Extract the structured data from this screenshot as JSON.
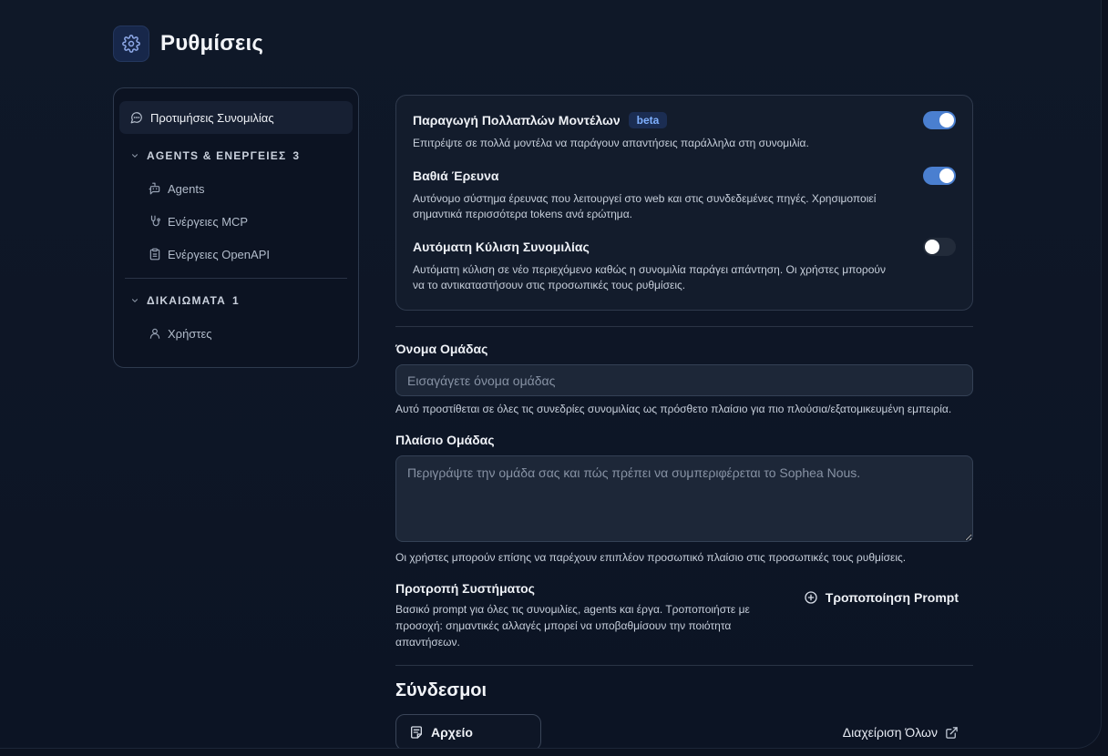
{
  "header": {
    "title": "Ρυθμίσεις",
    "icon": "gear-icon"
  },
  "sidebar": {
    "top_item": {
      "label": "Προτιμήσεις Συνομιλίας",
      "icon": "chat-bubble-icon"
    },
    "groups": [
      {
        "label": "AGENTS & ΕΝΕΡΓΕΙΕΣ",
        "count": "3",
        "items": [
          {
            "label": "Agents",
            "icon": "bot-message-icon"
          },
          {
            "label": "Ενέργειες MCP",
            "icon": "plug-route-icon"
          },
          {
            "label": "Ενέργειες OpenAPI",
            "icon": "clipboard-icon"
          }
        ]
      },
      {
        "label": "ΔΙΚΑΙΩΜΑΤΑ",
        "count": "1",
        "items": [
          {
            "label": "Χρήστες",
            "icon": "user-icon"
          }
        ]
      }
    ]
  },
  "options": [
    {
      "title": "Παραγωγή Πολλαπλών Μοντέλων",
      "badge": "beta",
      "description": "Επιτρέψτε σε πολλά μοντέλα να παράγουν απαντήσεις παράλληλα στη συνομιλία.",
      "enabled": true
    },
    {
      "title": "Βαθιά Έρευνα",
      "description": "Αυτόνομο σύστημα έρευνας που λειτουργεί στο web και στις συνδεδεμένες πηγές. Χρησιμοποιεί σημαντικά περισσότερα tokens ανά ερώτημα.",
      "enabled": true
    },
    {
      "title": "Αυτόματη Κύλιση Συνομιλίας",
      "description": "Αυτόματη κύλιση σε νέο περιεχόμενο καθώς η συνομιλία παράγει απάντηση. Οι χρήστες μπορούν να το αντικαταστήσουν στις προσωπικές τους ρυθμίσεις.",
      "enabled": false
    }
  ],
  "team_name": {
    "label": "Όνομα Ομάδας",
    "placeholder": "Εισαγάγετε όνομα ομάδας",
    "value": "",
    "help": "Αυτό προστίθεται σε όλες τις συνεδρίες συνομιλίας ως πρόσθετο πλαίσιο για πιο πλούσια/εξατομικευμένη εμπειρία."
  },
  "team_context": {
    "label": "Πλαίσιο Ομάδας",
    "placeholder": "Περιγράψτε την ομάδα σας και πώς πρέπει να συμπεριφέρεται το Sophea Nous.",
    "value": "",
    "help": "Οι χρήστες μπορούν επίσης να παρέχουν επιπλέον προσωπικό πλαίσιο στις προσωπικές τους ρυθμίσεις."
  },
  "system_prompt": {
    "title": "Προτροπή Συστήματος",
    "description": "Βασικό prompt για όλες τις συνομιλίες, agents και έργα. Τροποποιήστε με προσοχή: σημαντικές αλλαγές μπορεί να υποβαθμίσουν την ποιότητα απαντήσεων.",
    "button_label": "Τροποποίηση Prompt",
    "button_icon": "plus-circle-icon"
  },
  "links": {
    "title": "Σύνδεσμοι",
    "file_button": {
      "label": "Αρχείο",
      "icon": "file-text-icon"
    },
    "manage_label": "Διαχείριση Όλων",
    "manage_icon": "external-link-icon"
  },
  "colors": {
    "accent": "#4a7fd0",
    "badge_text": "#7fb0ff",
    "background": "#0f1828"
  }
}
